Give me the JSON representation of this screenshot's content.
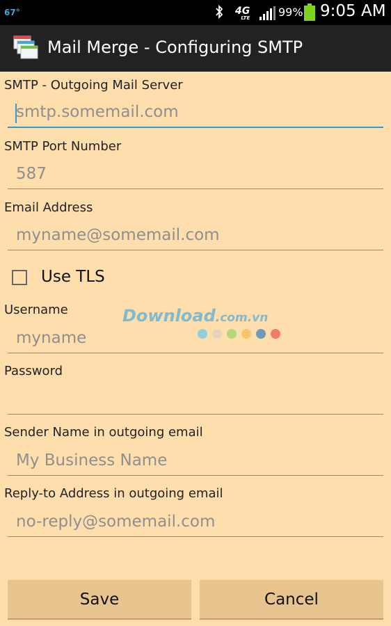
{
  "status_bar": {
    "temperature": "67°",
    "network": "4G",
    "network_sub": "LTE",
    "battery_percent": "99%",
    "time": "9:05 AM",
    "icons": [
      "bluetooth-icon",
      "signal-icon",
      "battery-icon"
    ]
  },
  "title_bar": {
    "title": "Mail Merge - Configuring SMTP",
    "icon": "mail-merge-app-icon"
  },
  "fields": {
    "smtp_server": {
      "label": "SMTP - Outgoing Mail Server",
      "placeholder": "smtp.somemail.com"
    },
    "smtp_port": {
      "label": "SMTP Port Number",
      "placeholder": "587"
    },
    "email": {
      "label": "Email Address",
      "placeholder": "myname@somemail.com"
    },
    "use_tls": {
      "label": "Use TLS"
    },
    "username": {
      "label": "Username",
      "placeholder": "myname"
    },
    "password": {
      "label": "Password",
      "placeholder": ""
    },
    "sender_name": {
      "label": "Sender Name in outgoing email",
      "placeholder": "My Business Name"
    },
    "reply_to": {
      "label": "Reply-to Address in outgoing email",
      "placeholder": "no-reply@somemail.com"
    }
  },
  "watermark": {
    "text": "Download",
    "suffix": ".com.vn"
  },
  "buttons": {
    "save": "Save",
    "cancel": "Cancel"
  },
  "colors": {
    "background": "#FDDEAC",
    "focus_accent": "#2c9ad3",
    "title_bar": "#222222",
    "button": "#E8C48E"
  }
}
